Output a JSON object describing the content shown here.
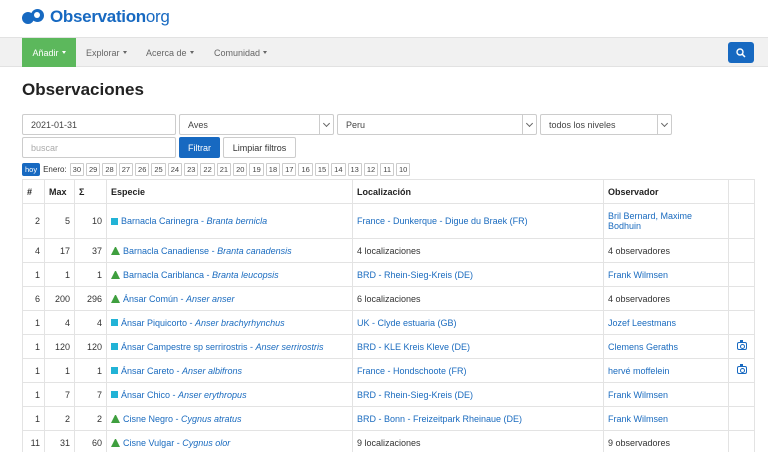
{
  "logo": {
    "name": "Observation",
    "suffix": "org"
  },
  "nav": {
    "add": "Añadir",
    "explore": "Explorar",
    "about": "Acerca de",
    "community": "Comunidad"
  },
  "page_title": "Observaciones",
  "filters": {
    "date": "2021-01-31",
    "group": "Aves",
    "country": "Peru",
    "level": "todos los niveles",
    "search_placeholder": "buscar",
    "filter_button": "Filtrar",
    "clear_button": "Limpiar filtros"
  },
  "dates": {
    "today": "hoy",
    "month": "Enero:",
    "days": [
      "30",
      "29",
      "28",
      "27",
      "26",
      "25",
      "24",
      "23",
      "22",
      "21",
      "20",
      "19",
      "18",
      "17",
      "16",
      "15",
      "14",
      "13",
      "12",
      "11",
      "10"
    ]
  },
  "table": {
    "headers": [
      "#",
      "Max",
      "Σ",
      "Especie",
      "Localización",
      "Observador",
      ""
    ],
    "rows": [
      {
        "n": "2",
        "max": "5",
        "sum": "10",
        "icon": "square",
        "common": "Barnacla Carinegra",
        "sci": "Branta bernicla",
        "loc": "France - Dunkerque - Digue du Braek (FR)",
        "loc_link": true,
        "obs": "Bril Bernard, Maxime Bodhuin",
        "obs_link": true,
        "photo": false,
        "tall": true
      },
      {
        "n": "4",
        "max": "17",
        "sum": "37",
        "icon": "triangle",
        "common": "Barnacla Canadiense",
        "sci": "Branta canadensis",
        "loc": "4 localizaciones",
        "loc_link": false,
        "obs": "4 observadores",
        "obs_link": false,
        "photo": false
      },
      {
        "n": "1",
        "max": "1",
        "sum": "1",
        "icon": "triangle",
        "common": "Barnacla Cariblanca",
        "sci": "Branta leucopsis",
        "loc": "BRD - Rhein-Sieg-Kreis (DE)",
        "loc_link": true,
        "obs": "Frank Wilmsen",
        "obs_link": true,
        "photo": false
      },
      {
        "n": "6",
        "max": "200",
        "sum": "296",
        "icon": "triangle",
        "common": "Ánsar Común",
        "sci": "Anser anser",
        "loc": "6 localizaciones",
        "loc_link": false,
        "obs": "4 observadores",
        "obs_link": false,
        "photo": false
      },
      {
        "n": "1",
        "max": "4",
        "sum": "4",
        "icon": "square",
        "common": "Ánsar Piquicorto",
        "sci": "Anser brachyrhynchus",
        "loc": "UK - Clyde estuaria (GB)",
        "loc_link": true,
        "obs": "Jozef Leestmans",
        "obs_link": true,
        "photo": false
      },
      {
        "n": "1",
        "max": "120",
        "sum": "120",
        "icon": "square",
        "common": "Ánsar Campestre sp serrirostris",
        "sci": "Anser serrirostris",
        "loc": "BRD - KLE Kreis Kleve (DE)",
        "loc_link": true,
        "obs": "Clemens Geraths",
        "obs_link": true,
        "photo": true
      },
      {
        "n": "1",
        "max": "1",
        "sum": "1",
        "icon": "square",
        "common": "Ánsar Careto",
        "sci": "Anser albifrons",
        "loc": "France - Hondschoote (FR)",
        "loc_link": true,
        "obs": "hervé moffelein",
        "obs_link": true,
        "photo": true
      },
      {
        "n": "1",
        "max": "7",
        "sum": "7",
        "icon": "square",
        "common": "Ánsar Chico",
        "sci": "Anser erythropus",
        "loc": "BRD - Rhein-Sieg-Kreis (DE)",
        "loc_link": true,
        "obs": "Frank Wilmsen",
        "obs_link": true,
        "photo": false
      },
      {
        "n": "1",
        "max": "2",
        "sum": "2",
        "icon": "triangle",
        "common": "Cisne Negro",
        "sci": "Cygnus atratus",
        "loc": "BRD - Bonn - Freizeitpark Rheinaue (DE)",
        "loc_link": true,
        "obs": "Frank Wilmsen",
        "obs_link": true,
        "photo": false
      },
      {
        "n": "11",
        "max": "31",
        "sum": "60",
        "icon": "triangle",
        "common": "Cisne Vulgar",
        "sci": "Cygnus olor",
        "loc": "9 localizaciones",
        "loc_link": false,
        "obs": "9 observadores",
        "obs_link": false,
        "photo": false
      }
    ]
  }
}
